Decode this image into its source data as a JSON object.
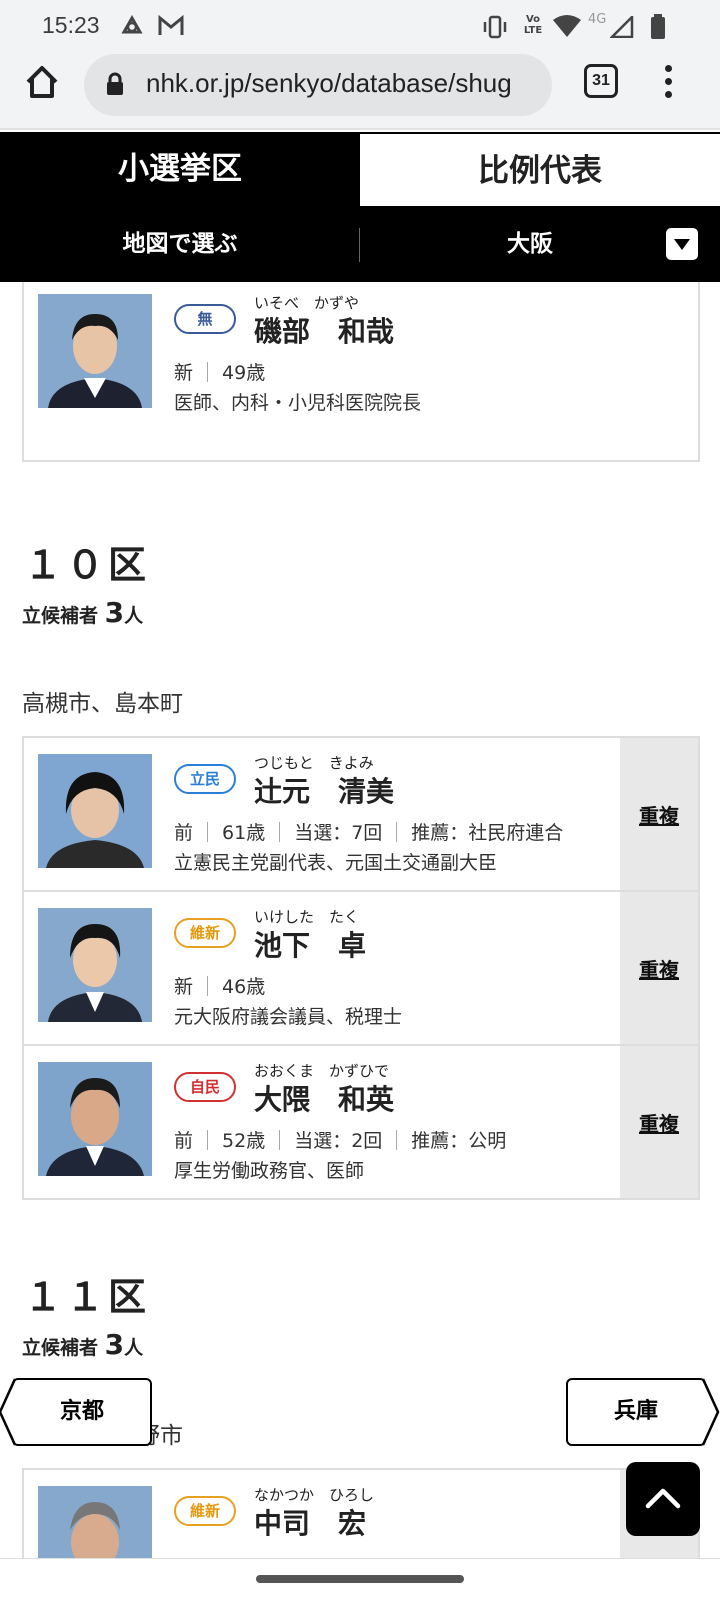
{
  "status_bar": {
    "time": "15:23",
    "icons": [
      "sync-icon",
      "gmail-icon",
      "vibrate-icon",
      "volte-icon",
      "wifi-icon",
      "4g-icon",
      "signal-icon",
      "battery-icon"
    ],
    "volte_label": "Vo LTE",
    "network_label": "4G"
  },
  "browser": {
    "url": "nhk.or.jp/senkyo/database/shug",
    "tab_count": "31"
  },
  "tabs": {
    "active": "小選挙区",
    "inactive": "比例代表"
  },
  "subnav": {
    "map_label": "地図で選ぶ",
    "prefecture": "大阪"
  },
  "top_card": {
    "party": "無",
    "kana": "いそべ　かずや",
    "name": "磯部　和哉",
    "status": "新",
    "age": "49歳",
    "career": "医師、内科・小児科医院院長"
  },
  "district_10": {
    "title": "１０区",
    "count_label": "立候補者",
    "count": "3",
    "count_unit": "人",
    "area": "高槻市、島本町",
    "candidates": [
      {
        "party": "立民",
        "kana": "つじもと　きよみ",
        "name": "辻元　清美",
        "status": "前",
        "age": "61歳",
        "elected": "当選：7回",
        "endorse": "推薦：社民府連合",
        "career": "立憲民主党副代表、元国土交通副大臣",
        "dup": "重複"
      },
      {
        "party": "維新",
        "kana": "いけした　たく",
        "name": "池下　卓",
        "status": "新",
        "age": "46歳",
        "career": "元大阪府議会議員、税理士",
        "dup": "重複"
      },
      {
        "party": "自民",
        "kana": "おおくま　かずひで",
        "name": "大隈　和英",
        "status": "前",
        "age": "52歳",
        "elected": "当選：2回",
        "endorse": "推薦：公明",
        "career": "厚生労働政務官、医師",
        "dup": "重複"
      }
    ]
  },
  "district_11": {
    "title": "１１区",
    "count_label": "立候補者",
    "count": "3",
    "count_unit": "人",
    "area": "枚方市、交野市",
    "first_candidate": {
      "party": "維新",
      "kana": "なかつか　ひろし",
      "name": "中司　宏"
    }
  },
  "pref_nav": {
    "prev": "京都",
    "next": "兵庫"
  }
}
